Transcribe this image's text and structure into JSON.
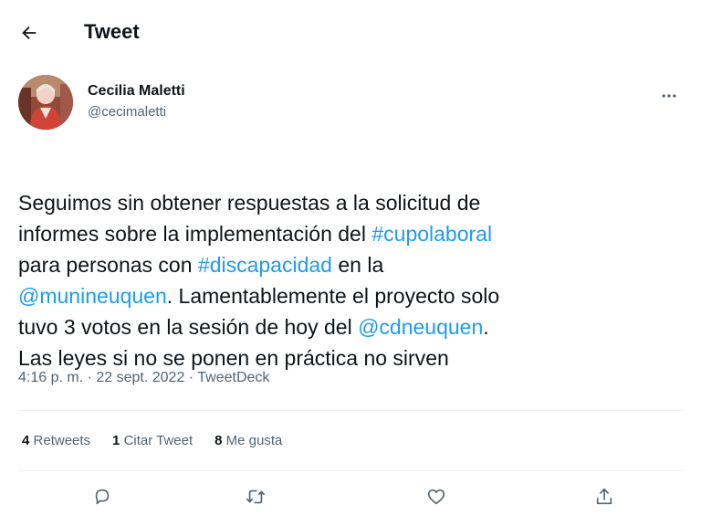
{
  "header": {
    "title": "Tweet",
    "back_icon": "arrow-left-icon"
  },
  "author": {
    "name": "Cecilia Maletti",
    "handle": "@cecimaletti",
    "more_icon": "more-horizontal-icon"
  },
  "tweet": {
    "segments": [
      {
        "text": "Seguimos sin obtener respuestas a la solicitud de\ninformes sobre la implementación del ",
        "link": false
      },
      {
        "text": "#cupolaboral",
        "link": true
      },
      {
        "text": "\npara personas con ",
        "link": false
      },
      {
        "text": "#discapacidad",
        "link": true
      },
      {
        "text": " en la\n",
        "link": false
      },
      {
        "text": "@munineuquen",
        "link": true
      },
      {
        "text": ". Lamentablemente el proyecto solo\ntuvo 3 votos en la sesión de hoy del ",
        "link": false
      },
      {
        "text": "@cdneuquen",
        "link": true
      },
      {
        "text": ".\nLas leyes si no se ponen en práctica no sirven",
        "link": false
      }
    ]
  },
  "meta": {
    "time": "4:16 p. m.",
    "separator": " · ",
    "date": "22 sept. 2022",
    "source": "TweetDeck"
  },
  "stats": {
    "retweets_count": "4",
    "retweets_label": "Retweets",
    "quotes_count": "1",
    "quotes_label": "Citar Tweet",
    "likes_count": "8",
    "likes_label": "Me gusta"
  },
  "actions": {
    "reply_icon": "reply-icon",
    "retweet_icon": "retweet-icon",
    "like_icon": "heart-icon",
    "share_icon": "share-icon"
  },
  "colors": {
    "link": "#1d9bf0",
    "text": "#0f1419",
    "secondary": "#536471",
    "divider": "#eff3f4"
  }
}
